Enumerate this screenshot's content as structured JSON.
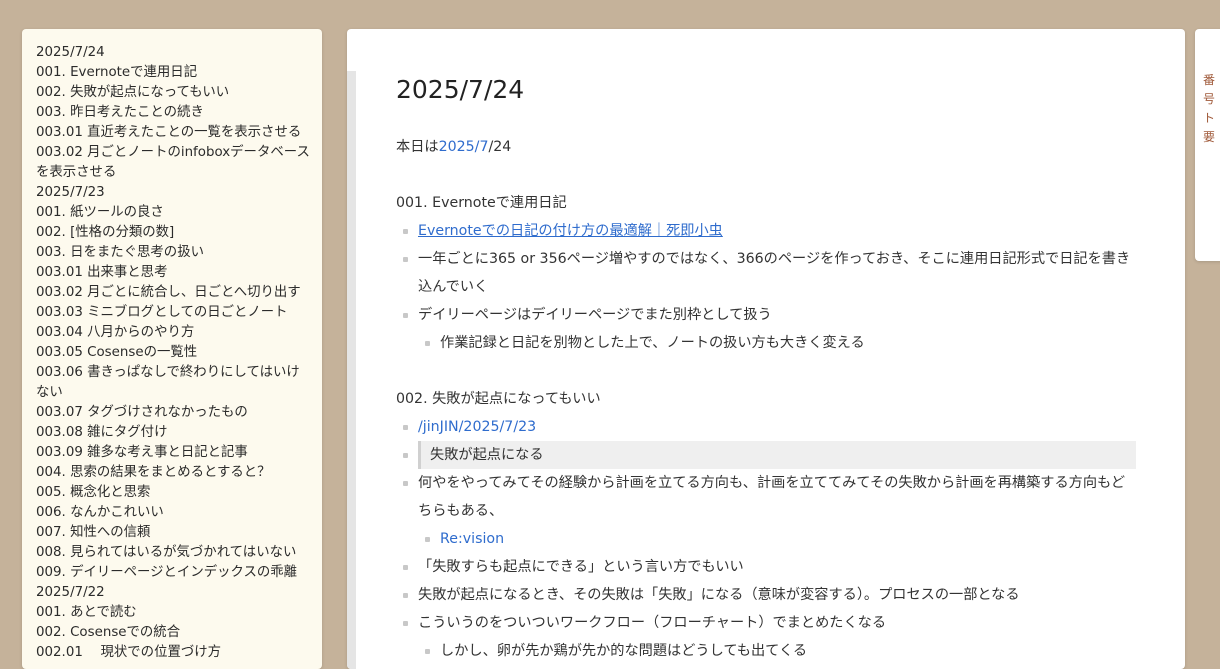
{
  "toc": [
    "2025/7/24",
    "001. Evernoteで連用日記",
    "002. 失敗が起点になってもいい",
    "003. 昨日考えたことの続き",
    "003.01 直近考えたことの一覧を表示させる",
    "003.02 月ごとノートのinfoboxデータベースを表示させる",
    "2025/7/23",
    "001. 紙ツールの良さ",
    "002. [性格の分類の数]",
    "003. 日をまたぐ思考の扱い",
    "003.01 出来事と思考",
    "003.02 月ごとに統合し、日ごとへ切り出す",
    "003.03 ミニブログとしての日ごとノート",
    "003.04 八月からのやり方",
    "003.05 Cosenseの一覧性",
    "003.06 書きっぱなしで終わりにしてはいけない",
    "003.07 タグづけされなかったもの",
    "003.08 雑にタグ付け",
    "003.09 雑多な考え事と日記と記事",
    "004. 思索の結果をまとめるとすると？",
    "005. 概念化と思索",
    "006. なんかこれいい",
    "007. 知性への信頼",
    "008. 見られてはいるが気づかれてはいない",
    "009. デイリーページとインデックスの乖離",
    "2025/7/22",
    "001. あとで読む",
    "002. Cosenseでの統合",
    "002.01 　現状での位置づけ方"
  ],
  "page": {
    "title": "2025/7/24",
    "intro": {
      "prefix": "本日は",
      "link": "2025/7",
      "suffix": "/24"
    },
    "s1_heading": "001. Evernoteで連用日記",
    "s1_link": "Evernoteでの日記の付け方の最適解｜死即小虫",
    "s1_b2": "一年ごとに365 or 356ページ増やすのではなく、366のページを作っておき、そこに連用日記形式で日記を書き込んでいく",
    "s1_b3": "デイリーページはデイリーページでまた別枠として扱う",
    "s1_b3_sub": "作業記録と日記を別物とした上で、ノートの扱い方も大きく変える",
    "s2_heading": "002. 失敗が起点になってもいい",
    "s2_link": "/jinJIN/2025/7/23",
    "s2_quote": "失敗が起点になる",
    "s2_b3": "何やをやってみてその経験から計画を立てる方向も、計画を立ててみてその失敗から計画を再構築する方向もどちらもある、",
    "s2_b3_sub": "Re:vision",
    "s2_b4": "「失敗すらも起点にできる」という言い方でもいい",
    "s2_b5": "失敗が起点になるとき、その失敗は「失敗」になる（意味が変容する）。プロセスの一部となる",
    "s2_b6": "こういうのをついついワークフロー（フローチャート）でまとめたくなる",
    "s2_b6_sub": "しかし、卵が先か鶏が先か的な問題はどうしても出てくる"
  },
  "right_panel": {
    "text": "番号ト要"
  }
}
